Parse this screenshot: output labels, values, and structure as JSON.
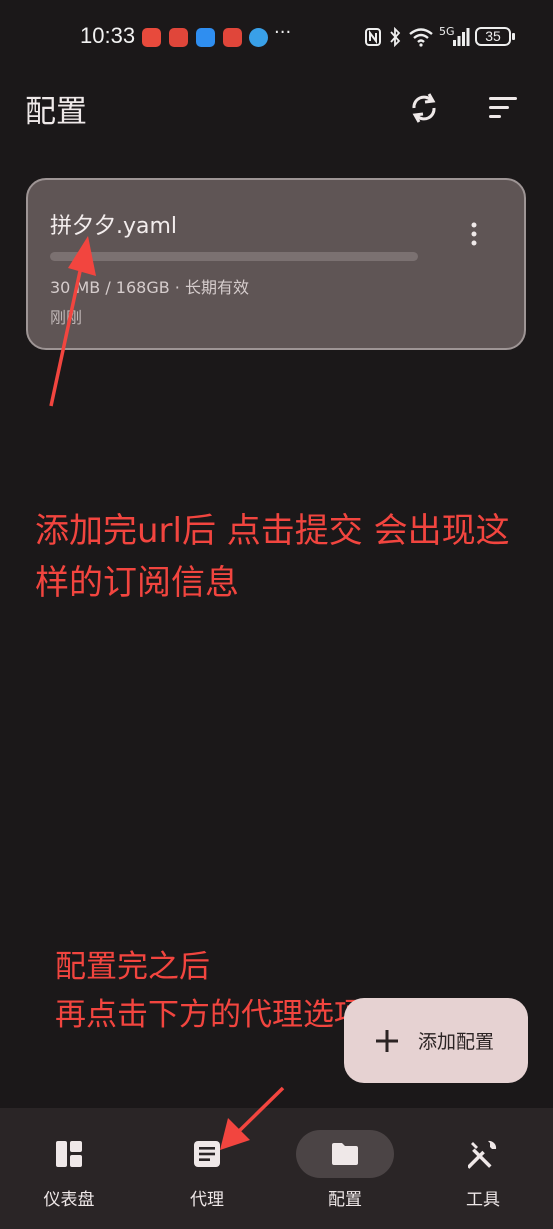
{
  "status_bar": {
    "time": "10:33",
    "more": "···",
    "network": "5G",
    "battery": "35"
  },
  "header": {
    "title": "配置",
    "refresh_icon": "refresh-icon",
    "sort_icon": "sort-icon"
  },
  "profile": {
    "name": "拼夕夕.yaml",
    "usage": "30 MB / 168GB · 长期有效",
    "updated": "刚刚",
    "usage_fraction": 0.0,
    "more_icon": "more-vert-icon"
  },
  "annotations": {
    "note1": "添加完url后 点击提交 会出现这样的订阅信息",
    "note2_line1": "配置完之后",
    "note2_line2": "再点击下方的代理选项",
    "color": "#f2453f"
  },
  "fab": {
    "label": "添加配置",
    "icon": "plus-icon"
  },
  "nav": {
    "items": [
      {
        "label": "仪表盘",
        "icon": "dashboard-icon"
      },
      {
        "label": "代理",
        "icon": "proxy-icon"
      },
      {
        "label": "配置",
        "icon": "folder-icon",
        "active": true
      },
      {
        "label": "工具",
        "icon": "tools-icon"
      }
    ]
  }
}
